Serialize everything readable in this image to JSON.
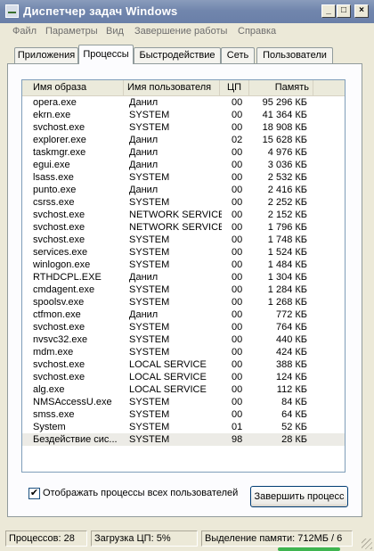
{
  "window": {
    "title": "Диспетчер задач Windows"
  },
  "menu": [
    "Файл",
    "Параметры",
    "Вид",
    "Завершение работы",
    "Справка"
  ],
  "tabs": [
    "Приложения",
    "Процессы",
    "Быстродействие",
    "Сеть",
    "Пользователи"
  ],
  "active_tab": "Процессы",
  "table": {
    "headers": [
      "Имя образа",
      "Имя пользователя",
      "ЦП",
      "Память"
    ],
    "rows": [
      [
        "opera.exe",
        "Данил",
        "00",
        "95 296 КБ"
      ],
      [
        "ekrn.exe",
        "SYSTEM",
        "00",
        "41 364 КБ"
      ],
      [
        "svchost.exe",
        "SYSTEM",
        "00",
        "18 908 КБ"
      ],
      [
        "explorer.exe",
        "Данил",
        "02",
        "15 628 КБ"
      ],
      [
        "taskmgr.exe",
        "Данил",
        "00",
        "4 976 КБ"
      ],
      [
        "egui.exe",
        "Данил",
        "00",
        "3 036 КБ"
      ],
      [
        "lsass.exe",
        "SYSTEM",
        "00",
        "2 532 КБ"
      ],
      [
        "punto.exe",
        "Данил",
        "00",
        "2 416 КБ"
      ],
      [
        "csrss.exe",
        "SYSTEM",
        "00",
        "2 252 КБ"
      ],
      [
        "svchost.exe",
        "NETWORK SERVICE",
        "00",
        "2 152 КБ"
      ],
      [
        "svchost.exe",
        "NETWORK SERVICE",
        "00",
        "1 796 КБ"
      ],
      [
        "svchost.exe",
        "SYSTEM",
        "00",
        "1 748 КБ"
      ],
      [
        "services.exe",
        "SYSTEM",
        "00",
        "1 524 КБ"
      ],
      [
        "winlogon.exe",
        "SYSTEM",
        "00",
        "1 484 КБ"
      ],
      [
        "RTHDCPL.EXE",
        "Данил",
        "00",
        "1 304 КБ"
      ],
      [
        "cmdagent.exe",
        "SYSTEM",
        "00",
        "1 284 КБ"
      ],
      [
        "spoolsv.exe",
        "SYSTEM",
        "00",
        "1 268 КБ"
      ],
      [
        "ctfmon.exe",
        "Данил",
        "00",
        "772 КБ"
      ],
      [
        "svchost.exe",
        "SYSTEM",
        "00",
        "764 КБ"
      ],
      [
        "nvsvc32.exe",
        "SYSTEM",
        "00",
        "440 КБ"
      ],
      [
        "mdm.exe",
        "SYSTEM",
        "00",
        "424 КБ"
      ],
      [
        "svchost.exe",
        "LOCAL SERVICE",
        "00",
        "388 КБ"
      ],
      [
        "svchost.exe",
        "LOCAL SERVICE",
        "00",
        "124 КБ"
      ],
      [
        "alg.exe",
        "LOCAL SERVICE",
        "00",
        "112 КБ"
      ],
      [
        "NMSAccessU.exe",
        "SYSTEM",
        "00",
        "84 КБ"
      ],
      [
        "smss.exe",
        "SYSTEM",
        "00",
        "64 КБ"
      ],
      [
        "System",
        "SYSTEM",
        "01",
        "52 КБ"
      ],
      [
        "Бездействие сис...",
        "SYSTEM",
        "98",
        "28 КБ"
      ]
    ],
    "selected_row": 27
  },
  "show_all_users": {
    "label": "Отображать процессы всех пользователей",
    "checked": true,
    "mark": "✔"
  },
  "end_process_button": "Завершить процесс",
  "status": {
    "processes": "Процессов: 28",
    "cpu": "Загрузка ЦП: 5%",
    "memory": "Выделение памяти: 712МБ / 6"
  },
  "icons": {
    "minimize": "_",
    "maximize": "□",
    "close": "×"
  }
}
